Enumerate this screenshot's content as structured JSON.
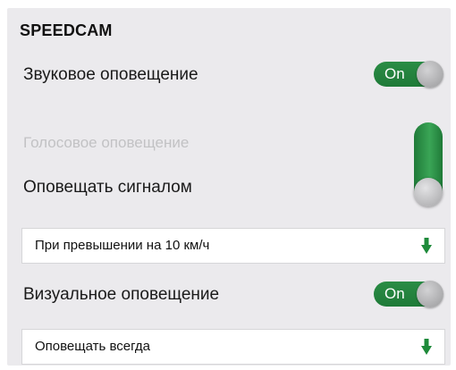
{
  "section": {
    "title": "SPEEDCAM"
  },
  "settings": {
    "sound_alert": {
      "label": "Звуковое оповещение",
      "toggle_text": "On",
      "enabled": true
    },
    "voice_alert": {
      "label": "Голосовое оповещение",
      "disabled": true
    },
    "signal_alert": {
      "label": "Оповещать сигналом",
      "enabled": true
    },
    "speed_threshold_select": {
      "value": "При превышении на 10 км/ч",
      "icon": "arrow-down-icon"
    },
    "visual_alert": {
      "label": "Визуальное оповещение",
      "toggle_text": "On",
      "enabled": true
    },
    "visual_mode_select": {
      "value": "Оповещать всегда",
      "icon": "arrow-down-icon"
    }
  },
  "colors": {
    "accent_green": "#1f7a38",
    "arrow_green": "#1e8a3a",
    "panel_bg": "#ebeaed",
    "disabled_text": "#c2c2c4"
  }
}
